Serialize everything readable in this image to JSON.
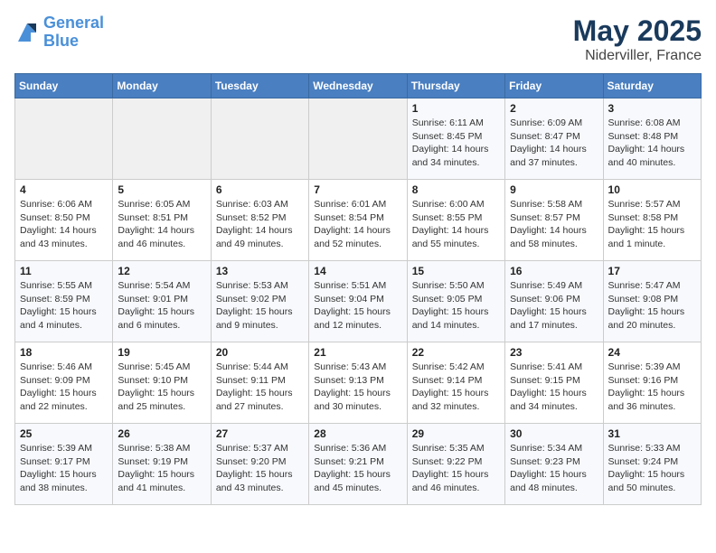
{
  "header": {
    "logo_line1": "General",
    "logo_line2": "Blue",
    "title": "May 2025",
    "subtitle": "Niderviller, France"
  },
  "days_of_week": [
    "Sunday",
    "Monday",
    "Tuesday",
    "Wednesday",
    "Thursday",
    "Friday",
    "Saturday"
  ],
  "weeks": [
    [
      {
        "day": "",
        "info": ""
      },
      {
        "day": "",
        "info": ""
      },
      {
        "day": "",
        "info": ""
      },
      {
        "day": "",
        "info": ""
      },
      {
        "day": "1",
        "info": "Sunrise: 6:11 AM\nSunset: 8:45 PM\nDaylight: 14 hours\nand 34 minutes."
      },
      {
        "day": "2",
        "info": "Sunrise: 6:09 AM\nSunset: 8:47 PM\nDaylight: 14 hours\nand 37 minutes."
      },
      {
        "day": "3",
        "info": "Sunrise: 6:08 AM\nSunset: 8:48 PM\nDaylight: 14 hours\nand 40 minutes."
      }
    ],
    [
      {
        "day": "4",
        "info": "Sunrise: 6:06 AM\nSunset: 8:50 PM\nDaylight: 14 hours\nand 43 minutes."
      },
      {
        "day": "5",
        "info": "Sunrise: 6:05 AM\nSunset: 8:51 PM\nDaylight: 14 hours\nand 46 minutes."
      },
      {
        "day": "6",
        "info": "Sunrise: 6:03 AM\nSunset: 8:52 PM\nDaylight: 14 hours\nand 49 minutes."
      },
      {
        "day": "7",
        "info": "Sunrise: 6:01 AM\nSunset: 8:54 PM\nDaylight: 14 hours\nand 52 minutes."
      },
      {
        "day": "8",
        "info": "Sunrise: 6:00 AM\nSunset: 8:55 PM\nDaylight: 14 hours\nand 55 minutes."
      },
      {
        "day": "9",
        "info": "Sunrise: 5:58 AM\nSunset: 8:57 PM\nDaylight: 14 hours\nand 58 minutes."
      },
      {
        "day": "10",
        "info": "Sunrise: 5:57 AM\nSunset: 8:58 PM\nDaylight: 15 hours\nand 1 minute."
      }
    ],
    [
      {
        "day": "11",
        "info": "Sunrise: 5:55 AM\nSunset: 8:59 PM\nDaylight: 15 hours\nand 4 minutes."
      },
      {
        "day": "12",
        "info": "Sunrise: 5:54 AM\nSunset: 9:01 PM\nDaylight: 15 hours\nand 6 minutes."
      },
      {
        "day": "13",
        "info": "Sunrise: 5:53 AM\nSunset: 9:02 PM\nDaylight: 15 hours\nand 9 minutes."
      },
      {
        "day": "14",
        "info": "Sunrise: 5:51 AM\nSunset: 9:04 PM\nDaylight: 15 hours\nand 12 minutes."
      },
      {
        "day": "15",
        "info": "Sunrise: 5:50 AM\nSunset: 9:05 PM\nDaylight: 15 hours\nand 14 minutes."
      },
      {
        "day": "16",
        "info": "Sunrise: 5:49 AM\nSunset: 9:06 PM\nDaylight: 15 hours\nand 17 minutes."
      },
      {
        "day": "17",
        "info": "Sunrise: 5:47 AM\nSunset: 9:08 PM\nDaylight: 15 hours\nand 20 minutes."
      }
    ],
    [
      {
        "day": "18",
        "info": "Sunrise: 5:46 AM\nSunset: 9:09 PM\nDaylight: 15 hours\nand 22 minutes."
      },
      {
        "day": "19",
        "info": "Sunrise: 5:45 AM\nSunset: 9:10 PM\nDaylight: 15 hours\nand 25 minutes."
      },
      {
        "day": "20",
        "info": "Sunrise: 5:44 AM\nSunset: 9:11 PM\nDaylight: 15 hours\nand 27 minutes."
      },
      {
        "day": "21",
        "info": "Sunrise: 5:43 AM\nSunset: 9:13 PM\nDaylight: 15 hours\nand 30 minutes."
      },
      {
        "day": "22",
        "info": "Sunrise: 5:42 AM\nSunset: 9:14 PM\nDaylight: 15 hours\nand 32 minutes."
      },
      {
        "day": "23",
        "info": "Sunrise: 5:41 AM\nSunset: 9:15 PM\nDaylight: 15 hours\nand 34 minutes."
      },
      {
        "day": "24",
        "info": "Sunrise: 5:39 AM\nSunset: 9:16 PM\nDaylight: 15 hours\nand 36 minutes."
      }
    ],
    [
      {
        "day": "25",
        "info": "Sunrise: 5:39 AM\nSunset: 9:17 PM\nDaylight: 15 hours\nand 38 minutes."
      },
      {
        "day": "26",
        "info": "Sunrise: 5:38 AM\nSunset: 9:19 PM\nDaylight: 15 hours\nand 41 minutes."
      },
      {
        "day": "27",
        "info": "Sunrise: 5:37 AM\nSunset: 9:20 PM\nDaylight: 15 hours\nand 43 minutes."
      },
      {
        "day": "28",
        "info": "Sunrise: 5:36 AM\nSunset: 9:21 PM\nDaylight: 15 hours\nand 45 minutes."
      },
      {
        "day": "29",
        "info": "Sunrise: 5:35 AM\nSunset: 9:22 PM\nDaylight: 15 hours\nand 46 minutes."
      },
      {
        "day": "30",
        "info": "Sunrise: 5:34 AM\nSunset: 9:23 PM\nDaylight: 15 hours\nand 48 minutes."
      },
      {
        "day": "31",
        "info": "Sunrise: 5:33 AM\nSunset: 9:24 PM\nDaylight: 15 hours\nand 50 minutes."
      }
    ]
  ]
}
